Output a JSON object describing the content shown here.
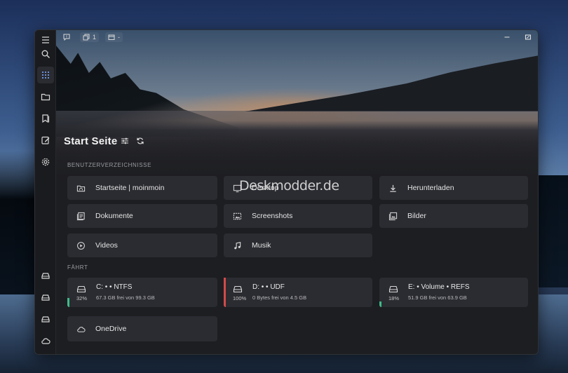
{
  "titlebar": {
    "tab_count": "1",
    "folder_btn": "-"
  },
  "header": {
    "title": "Start Seite"
  },
  "sections": {
    "user_dirs": "BENUTZERVERZEICHNISSE",
    "drives": "FÄHRT"
  },
  "user_dirs": [
    {
      "label": "Startseite | moinmoin",
      "icon": "home-folder-icon"
    },
    {
      "label": "Desktop",
      "icon": "desktop-icon"
    },
    {
      "label": "Herunterladen",
      "icon": "download-icon"
    },
    {
      "label": "Dokumente",
      "icon": "documents-icon"
    },
    {
      "label": "Screenshots",
      "icon": "screenshots-icon"
    },
    {
      "label": "Bilder",
      "icon": "pictures-icon"
    },
    {
      "label": "Videos",
      "icon": "videos-icon"
    },
    {
      "label": "Musik",
      "icon": "music-icon"
    }
  ],
  "drives": [
    {
      "name": "C: • • NTFS",
      "percent": "32%",
      "free": "67.3 GB frei von 99.3 GB",
      "used_fraction": 0.32,
      "color": "#3dbb8a"
    },
    {
      "name": "D: • • UDF",
      "percent": "100%",
      "free": "0 Bytes frei von 4.5 GB",
      "used_fraction": 1.0,
      "color": "#d24a4a"
    },
    {
      "name": "E: • Volume • REFS",
      "percent": "18%",
      "free": "51.9 GB frei von 63.9 GB",
      "used_fraction": 0.18,
      "color": "#3dbb8a"
    }
  ],
  "cloud": {
    "label": "OneDrive"
  },
  "watermark": "Deskmodder.de"
}
